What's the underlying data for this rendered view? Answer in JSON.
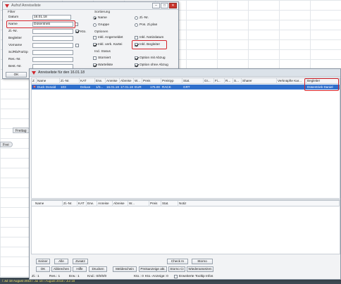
{
  "background": {
    "side_tags": [
      "Freitag",
      "Frei"
    ],
    "status_text": "/ Jul 18   August 2018 / Jul 18 / August 2018 / Jul 18"
  },
  "search_dialog": {
    "title": "Aufruf Anreiseliste",
    "filter_group": "Filter",
    "labels": {
      "datum": "Datum",
      "name": "Name",
      "zinr": "Zi.-Nr.",
      "begleiter": "Begleiter",
      "vorname": "Vorname",
      "sc": "Sc/Rb/Fa/Gp",
      "res": "Res.-Nr.",
      "best": "Best.-Nr."
    },
    "values": {
      "datum": "16.01.18",
      "name": "Düsentrieb"
    },
    "kto_label": "Kto.",
    "ok_label": "OK",
    "sorting": {
      "title": "Sortierung",
      "name": "Name",
      "zinr": "Zi.-Nr.",
      "gruppe": "Gruppe",
      "pos_zi_plan": "Pos. Zi.plan"
    },
    "options": {
      "title": "Optionen",
      "angemeldet": "Inkl. Angemeldet",
      "notizdatum": "Inkl. Notizdatum",
      "verk_kartei": "Inkl. verk. Kartei",
      "begleiter": "Inkl. Begleiter"
    },
    "ind_status": {
      "title": "Ind. Status",
      "storniert": "Storniert",
      "option_mit_abzug": "Option mit Abzug",
      "warteliste": "Warteliste",
      "option_ohne_abzug": "Option ohne Abzug"
    }
  },
  "list_window": {
    "title": "Anreiseliste für den 16.01.18",
    "columns": [
      "Z",
      "Name",
      "Zi.-Nr.",
      "KAT",
      "Erw.",
      "Anreise",
      "Abreise",
      "W...",
      "Preis",
      "Preistyp",
      "Stat.",
      "Gr...",
      "Fi...",
      "R...",
      "S...",
      "Sharer",
      "Verknüpfte Kar...",
      "Begleiter"
    ],
    "row": {
      "name": "Duck Donald",
      "zinr": "103",
      "kat": "Deluxe",
      "erw": "1/0...",
      "anreise": "16.01.18",
      "abreise": "17.01.18",
      "waehrung": "EUR",
      "preis": "175.00",
      "preistyp": "RACK",
      "stat": "GRT",
      "begleiter": "Düsentrieb Daniel"
    },
    "lower_columns": [
      "Name",
      "Zi.-Nr.",
      "KAT",
      "Erw.",
      "Anreise",
      "Abreise",
      "W...",
      "Preis",
      "Stat.",
      "Notiz"
    ],
    "buttons_row1": [
      "Keiner",
      "Alle",
      "Zusatz",
      "Check In",
      "Storno"
    ],
    "buttons_row2": [
      "OK",
      "Abbrechen",
      "Hilfe",
      "Drucken",
      "Meldeschein",
      "Preisanzeige akt.",
      "Storno CI",
      "Wiederansetzen"
    ],
    "status": {
      "zi": "Zi.: 1",
      "res": "Res.: 1",
      "erw": "Erw.: 1",
      "knd": "Knd.: 0/0/0/0",
      "kto": "Kto.: 0",
      "kto_anzeige": "Kto.-Anzeige: 0",
      "tooltip": "Erweiterte Tooltip Infos"
    }
  },
  "colors": {
    "highlight_red": "#d6252c",
    "selection_blue": "#2f6fcc",
    "window_border": "#8b96a3"
  }
}
